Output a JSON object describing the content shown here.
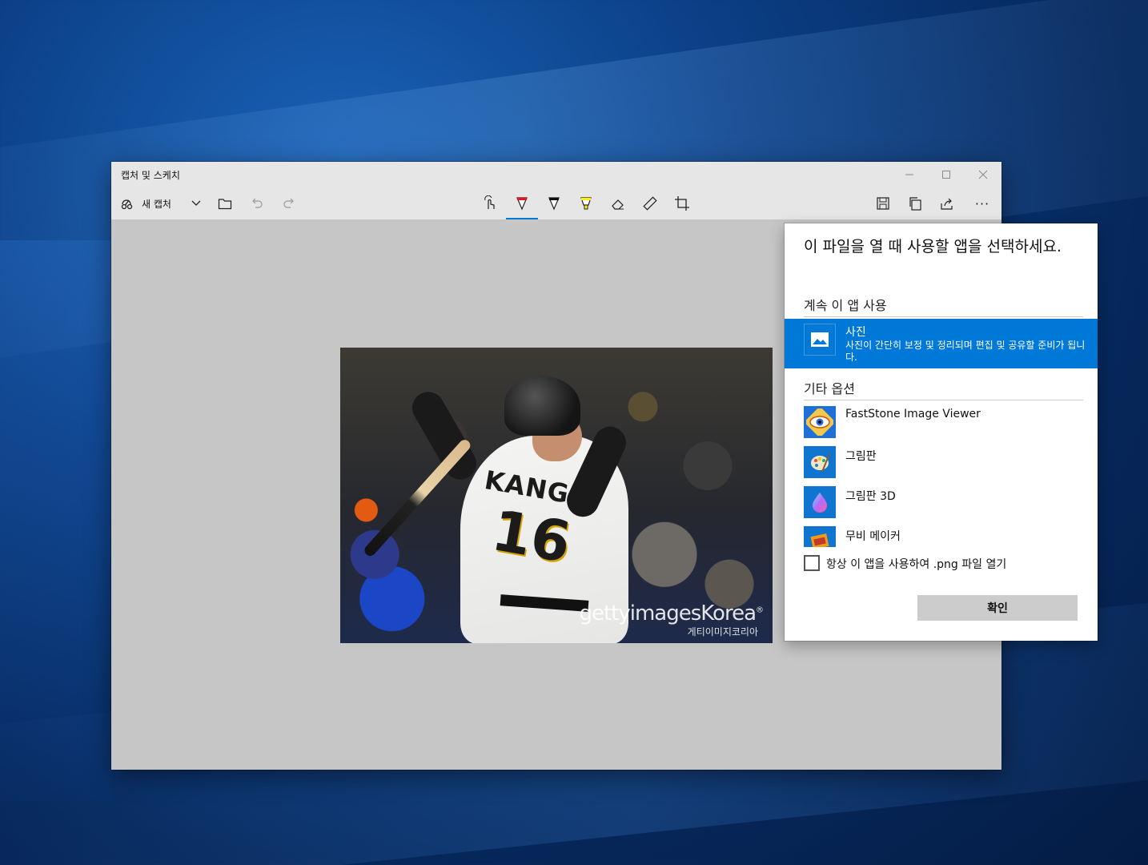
{
  "window": {
    "title": "캡처 및 스케치",
    "controls": {
      "minimize": "—",
      "maximize": "☐",
      "close": "✕"
    }
  },
  "toolbar": {
    "new_capture_label": "새 캡처",
    "overflow_label": "···",
    "active_tool": "ballpoint-pen"
  },
  "photo": {
    "jersey_name": "KANG",
    "jersey_number": "16",
    "watermark": "gettyimagesKorea",
    "watermark_symbol": "®",
    "watermark_sub": "게티이미지코리아"
  },
  "dialog": {
    "title": "이 파일을 열 때 사용할 앱을 선택하세요.",
    "keep_using_heading": "계속 이 앱 사용",
    "current_app": {
      "name": "사진",
      "description": "사진이 간단히 보정 및 정리되며 편집 및 공유할 준비가 됩니다.",
      "icon": "photos-icon"
    },
    "other_options_heading": "기타 옵션",
    "other_apps": [
      {
        "name": "FastStone Image Viewer",
        "icon": "faststone-eye-icon"
      },
      {
        "name": "그림판",
        "icon": "paint-palette-icon"
      },
      {
        "name": "그림판 3D",
        "icon": "paint3d-drop-icon"
      },
      {
        "name": "무비 메이커",
        "icon": "movie-maker-icon"
      }
    ],
    "always_use_label": "항상 이 앱을 사용하여 .png 파일 열기",
    "always_use_checked": false,
    "ok_label": "확인"
  },
  "colors": {
    "accent": "#0078d7",
    "titlebar": "#e6e6e6",
    "canvas": "#c6c6c6"
  }
}
